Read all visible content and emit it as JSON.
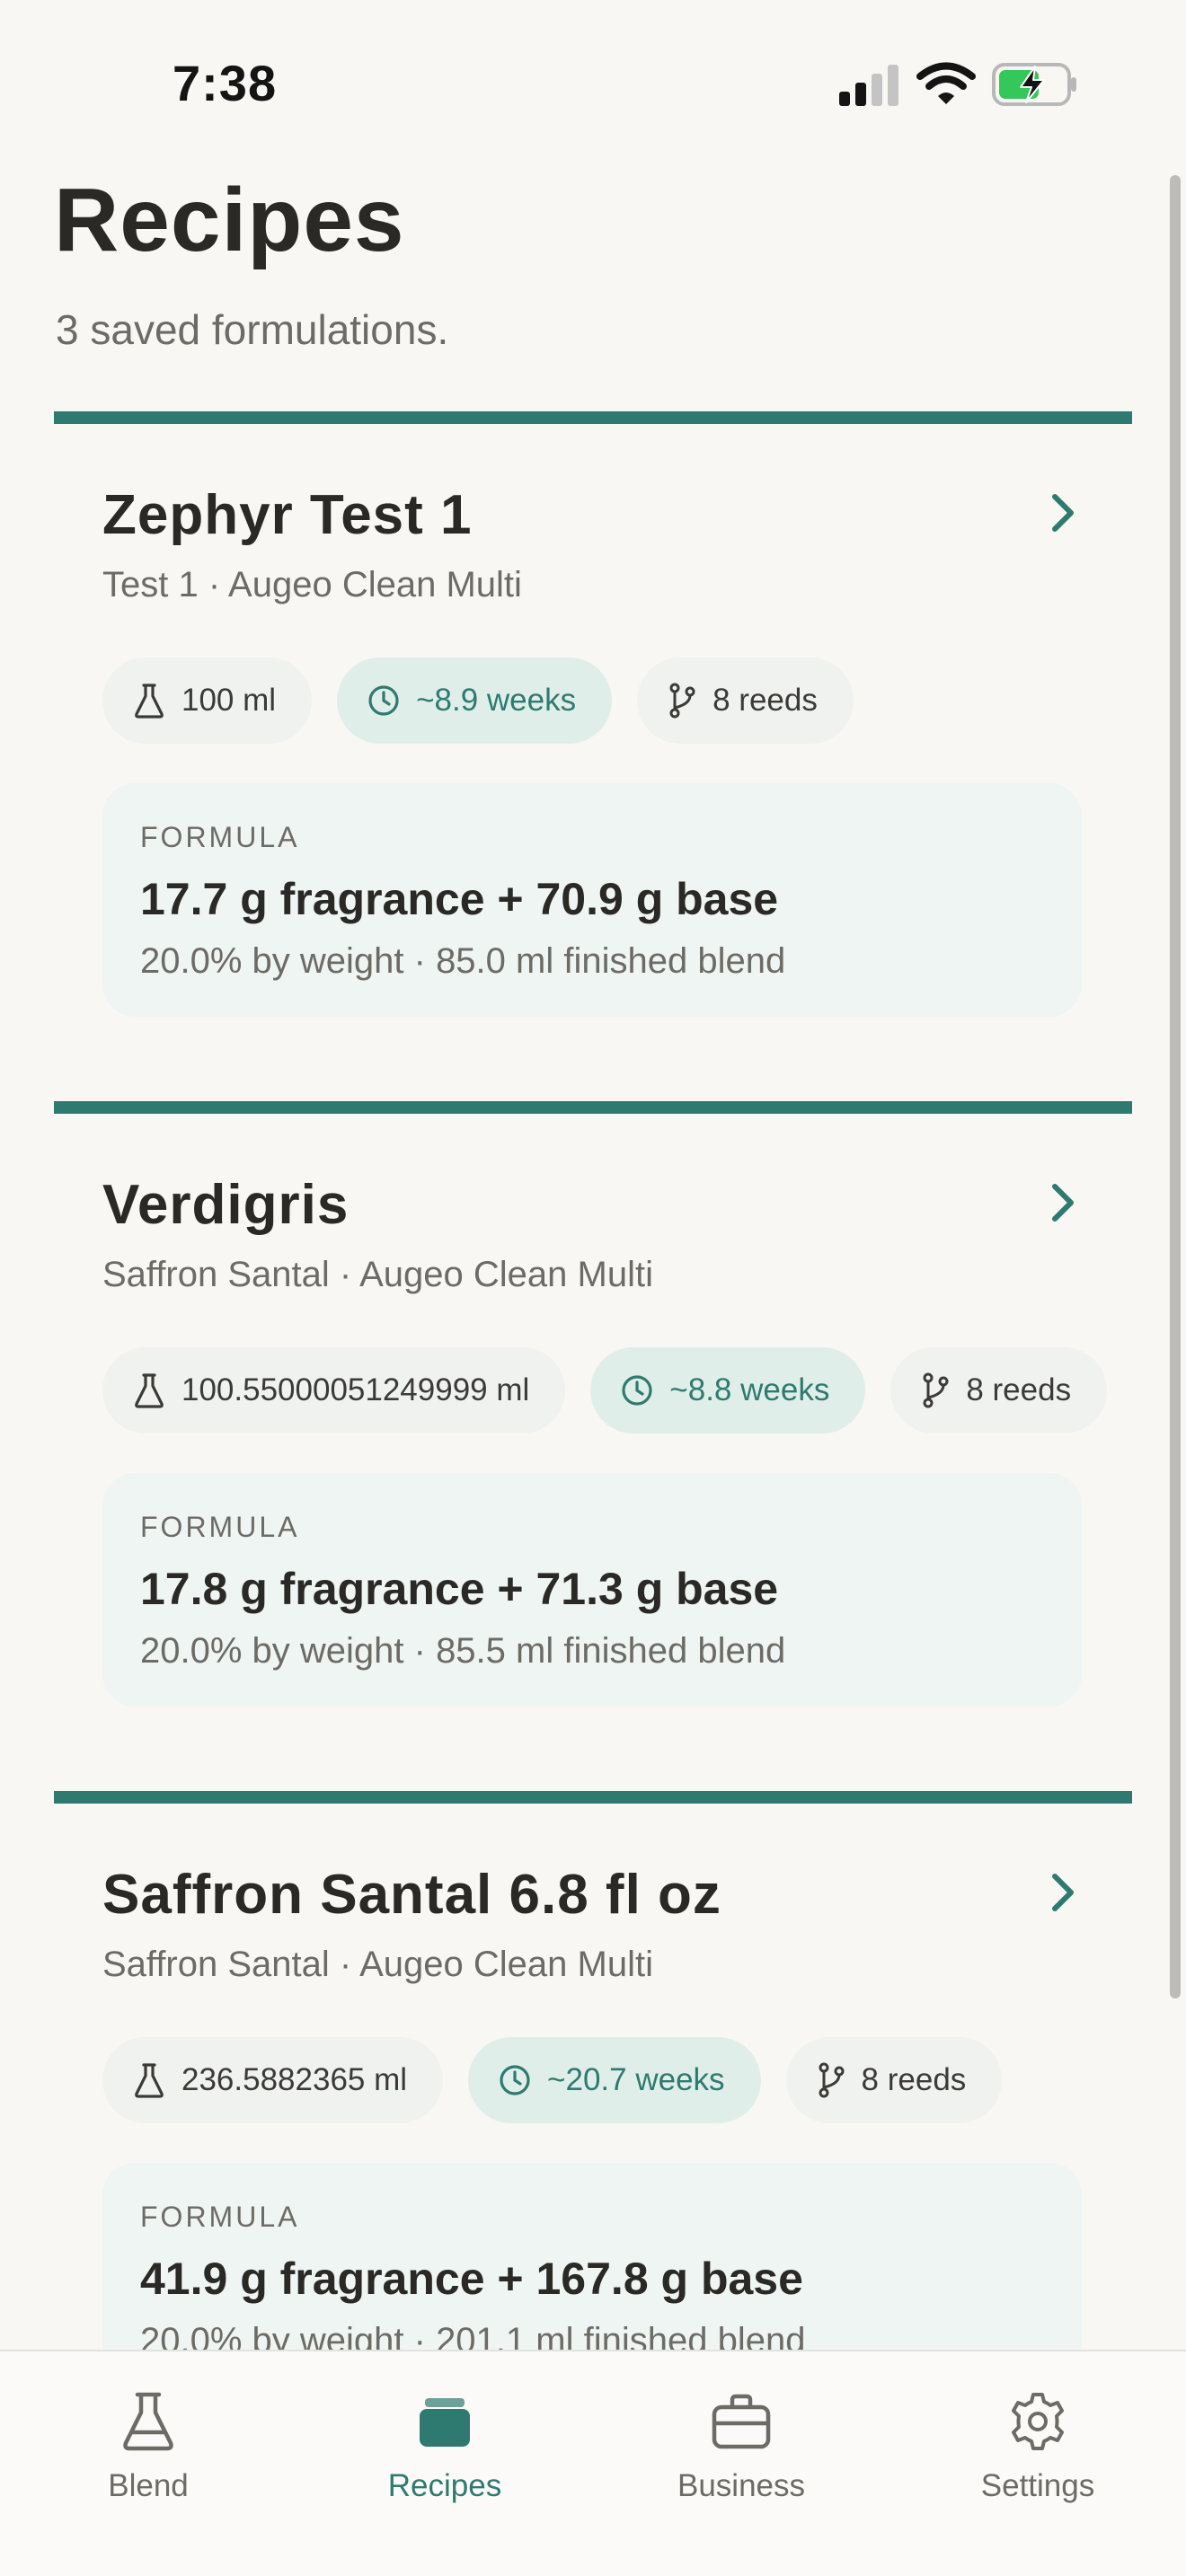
{
  "status_bar": {
    "time": "7:38"
  },
  "header": {
    "title": "Recipes",
    "subtitle": "3 saved formulations."
  },
  "colors": {
    "accent": "#2f7a70",
    "background": "#f8f7f4",
    "chip_time_bg": "#e0eeea"
  },
  "recipes": [
    {
      "name": "Zephyr Test 1",
      "source": "Test 1 · Augeo Clean Multi",
      "volume": "100 ml",
      "duration": "~8.9 weeks",
      "reeds": "8 reeds",
      "formula_label": "FORMULA",
      "formula_main": "17.7 g fragrance + 70.9 g base",
      "formula_detail": "20.0% by weight · 85.0 ml finished blend"
    },
    {
      "name": "Verdigris",
      "source": "Saffron Santal · Augeo Clean Multi",
      "volume": "100.55000051249999 ml",
      "duration": "~8.8 weeks",
      "reeds": "8 reeds",
      "formula_label": "FORMULA",
      "formula_main": "17.8 g fragrance + 71.3 g base",
      "formula_detail": "20.0% by weight · 85.5 ml finished blend"
    },
    {
      "name": "Saffron Santal 6.8 fl oz",
      "source": "Saffron Santal · Augeo Clean Multi",
      "volume": "236.5882365 ml",
      "duration": "~20.7 weeks",
      "reeds": "8 reeds",
      "formula_label": "FORMULA",
      "formula_main": "41.9 g fragrance + 167.8 g base",
      "formula_detail": "20.0% by weight · 201.1 ml finished blend"
    }
  ],
  "tabs": [
    {
      "label": "Blend",
      "icon": "flask-icon",
      "active": false
    },
    {
      "label": "Recipes",
      "icon": "folder-icon",
      "active": true
    },
    {
      "label": "Business",
      "icon": "briefcase-icon",
      "active": false
    },
    {
      "label": "Settings",
      "icon": "gear-icon",
      "active": false
    }
  ]
}
